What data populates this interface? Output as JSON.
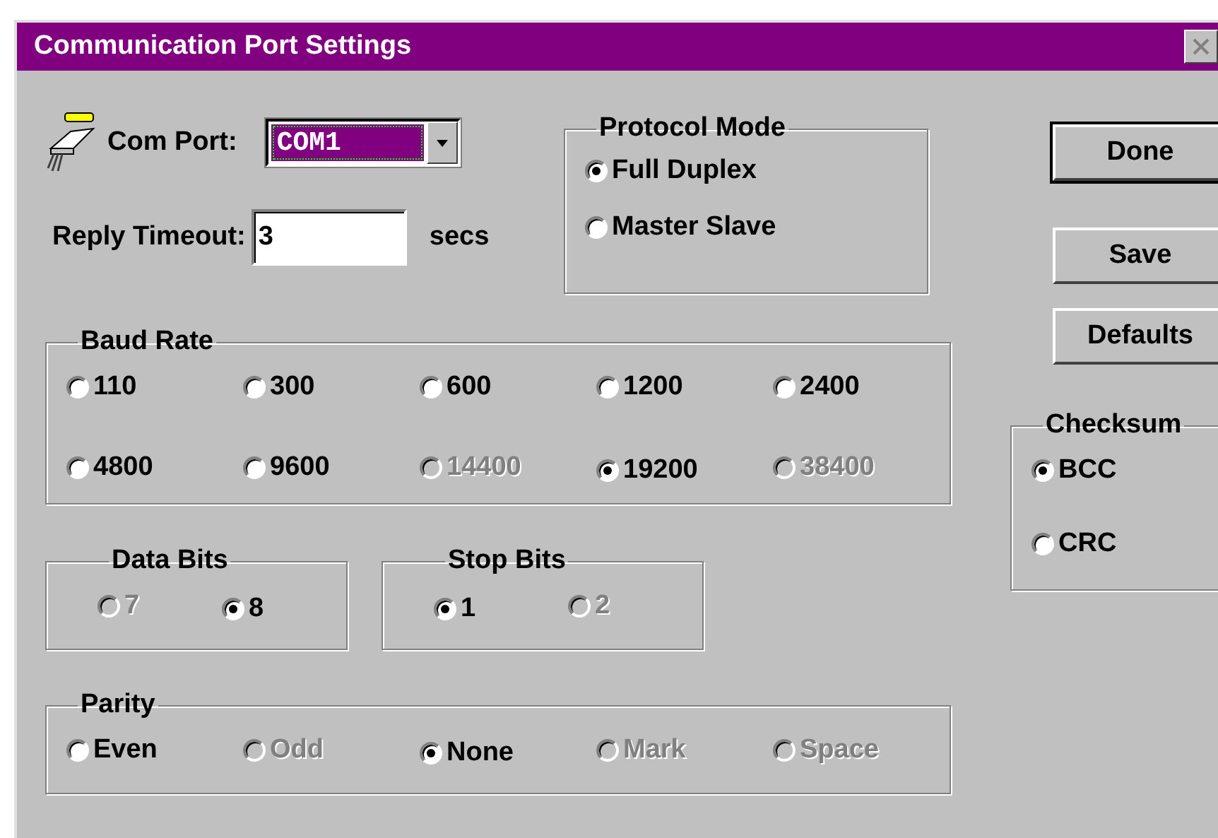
{
  "window": {
    "title": "Communication Port Settings"
  },
  "com_port": {
    "label": "Com Port:",
    "value": "COM1"
  },
  "reply_timeout": {
    "label": "Reply Timeout:",
    "value": "3",
    "unit": "secs"
  },
  "protocol_mode": {
    "title": "Protocol Mode",
    "options": [
      {
        "label": "Full Duplex",
        "selected": true,
        "disabled": false
      },
      {
        "label": "Master Slave",
        "selected": false,
        "disabled": false
      }
    ]
  },
  "baud_rate": {
    "title": "Baud Rate",
    "options": [
      {
        "label": "110",
        "selected": false,
        "disabled": false
      },
      {
        "label": "300",
        "selected": false,
        "disabled": false
      },
      {
        "label": "600",
        "selected": false,
        "disabled": false
      },
      {
        "label": "1200",
        "selected": false,
        "disabled": false
      },
      {
        "label": "2400",
        "selected": false,
        "disabled": false
      },
      {
        "label": "4800",
        "selected": false,
        "disabled": false
      },
      {
        "label": "9600",
        "selected": false,
        "disabled": false
      },
      {
        "label": "14400",
        "selected": false,
        "disabled": true
      },
      {
        "label": "19200",
        "selected": true,
        "disabled": false
      },
      {
        "label": "38400",
        "selected": false,
        "disabled": true
      }
    ]
  },
  "data_bits": {
    "title": "Data Bits",
    "options": [
      {
        "label": "7",
        "selected": false,
        "disabled": true
      },
      {
        "label": "8",
        "selected": true,
        "disabled": false
      }
    ]
  },
  "stop_bits": {
    "title": "Stop Bits",
    "options": [
      {
        "label": "1",
        "selected": true,
        "disabled": false
      },
      {
        "label": "2",
        "selected": false,
        "disabled": true
      }
    ]
  },
  "parity": {
    "title": "Parity",
    "options": [
      {
        "label": "Even",
        "selected": false,
        "disabled": false
      },
      {
        "label": "Odd",
        "selected": false,
        "disabled": true
      },
      {
        "label": "None",
        "selected": true,
        "disabled": false
      },
      {
        "label": "Mark",
        "selected": false,
        "disabled": true
      },
      {
        "label": "Space",
        "selected": false,
        "disabled": true
      }
    ]
  },
  "buttons": [
    {
      "label": "Done",
      "default": true
    },
    {
      "label": "Save",
      "default": false
    },
    {
      "label": "Defaults",
      "default": false
    }
  ],
  "checksum": {
    "title": "Checksum",
    "options": [
      {
        "label": "BCC",
        "selected": true,
        "disabled": false
      },
      {
        "label": "CRC",
        "selected": false,
        "disabled": false
      }
    ]
  }
}
